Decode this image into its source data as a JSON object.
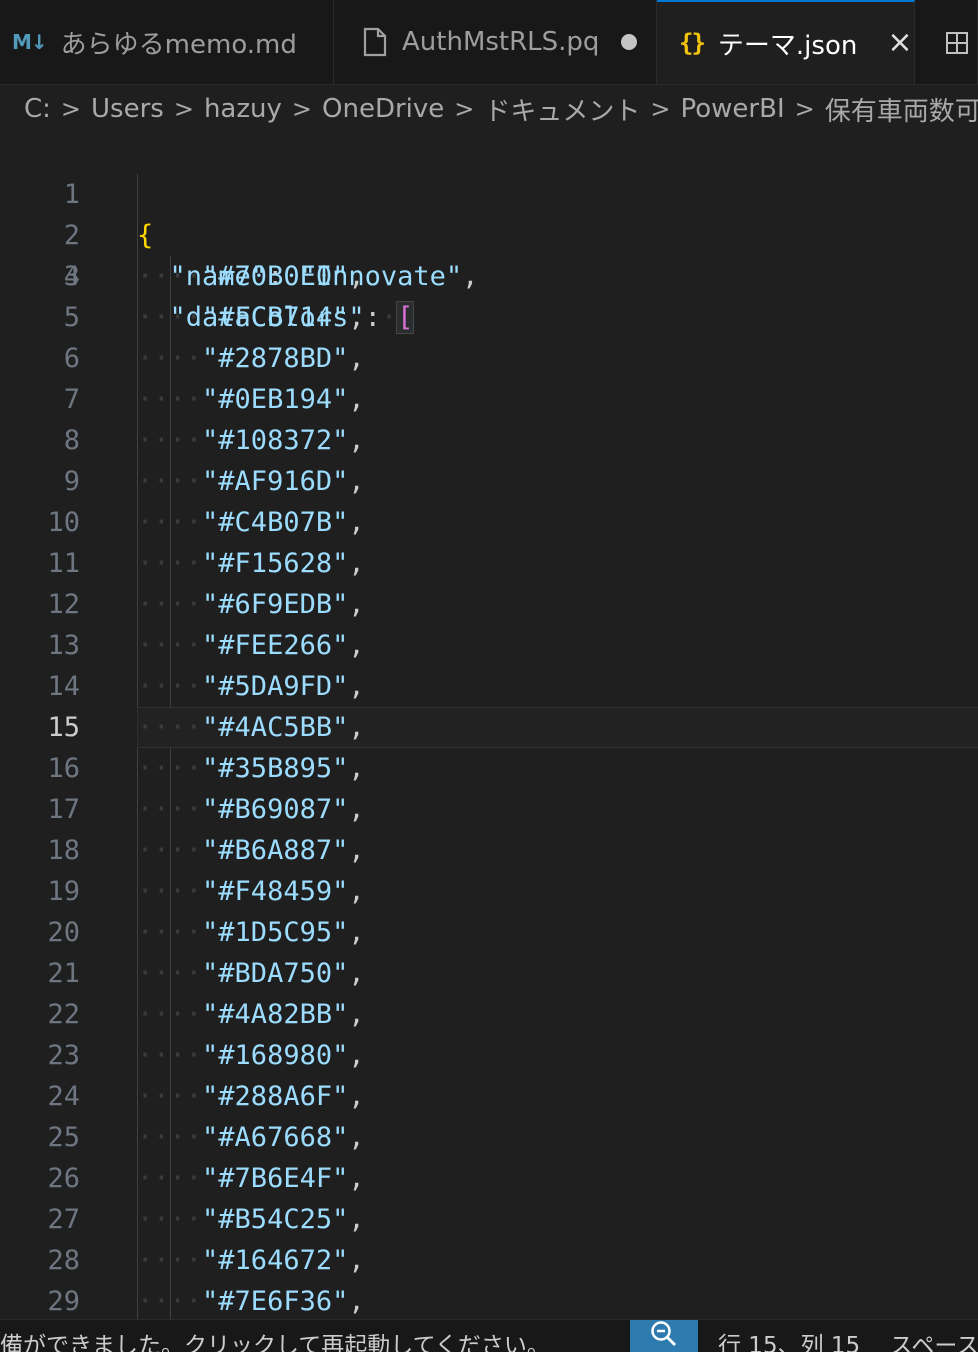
{
  "tabs": [
    {
      "icon": "markdown-icon",
      "icon_text": "M↓",
      "label": "あらゆるmemo.md"
    },
    {
      "icon": "file-icon",
      "label": "AuthMstRLS.pq",
      "dirty": true
    },
    {
      "icon": "json-braces-icon",
      "icon_text": "{}",
      "label": "テーマ.json",
      "active": true
    },
    {
      "icon": "split-editor-icon"
    }
  ],
  "breadcrumb": [
    "C:",
    "Users",
    "hazuy",
    "OneDrive",
    "ドキュメント",
    "PowerBI",
    "保有車両数可視化"
  ],
  "editor": {
    "current_line": 15,
    "line_numbers": [
      "1",
      "2",
      "3",
      "4",
      "5",
      "6",
      "7",
      "8",
      "9",
      "10",
      "11",
      "12",
      "13",
      "14",
      "15",
      "16",
      "17",
      "18",
      "19",
      "20",
      "21",
      "22",
      "23",
      "24",
      "25",
      "26",
      "27",
      "28",
      "29"
    ],
    "name_key": "\"name\"",
    "name_value": "\"Innovate\"",
    "colors_key": "\"dataColors\"",
    "colors": [
      "#70B0E0",
      "#FCB714",
      "#2878BD",
      "#0EB194",
      "#108372",
      "#AF916D",
      "#C4B07B",
      "#F15628",
      "#6F9EDB",
      "#FEE266",
      "#5DA9FD",
      "#4AC5BB",
      "#35B895",
      "#B69087",
      "#B6A887",
      "#F48459",
      "#1D5C95",
      "#BDA750",
      "#4A82BB",
      "#168980",
      "#288A6F",
      "#A67668",
      "#7B6E4F",
      "#B54C25",
      "#164672",
      "#7E6F36"
    ]
  },
  "status": {
    "message": "備ができました。クリックして再起動してください。",
    "position": "行 15、列 15",
    "indent": "スペース:",
    "zoom_icon": "zoom-out-icon"
  }
}
